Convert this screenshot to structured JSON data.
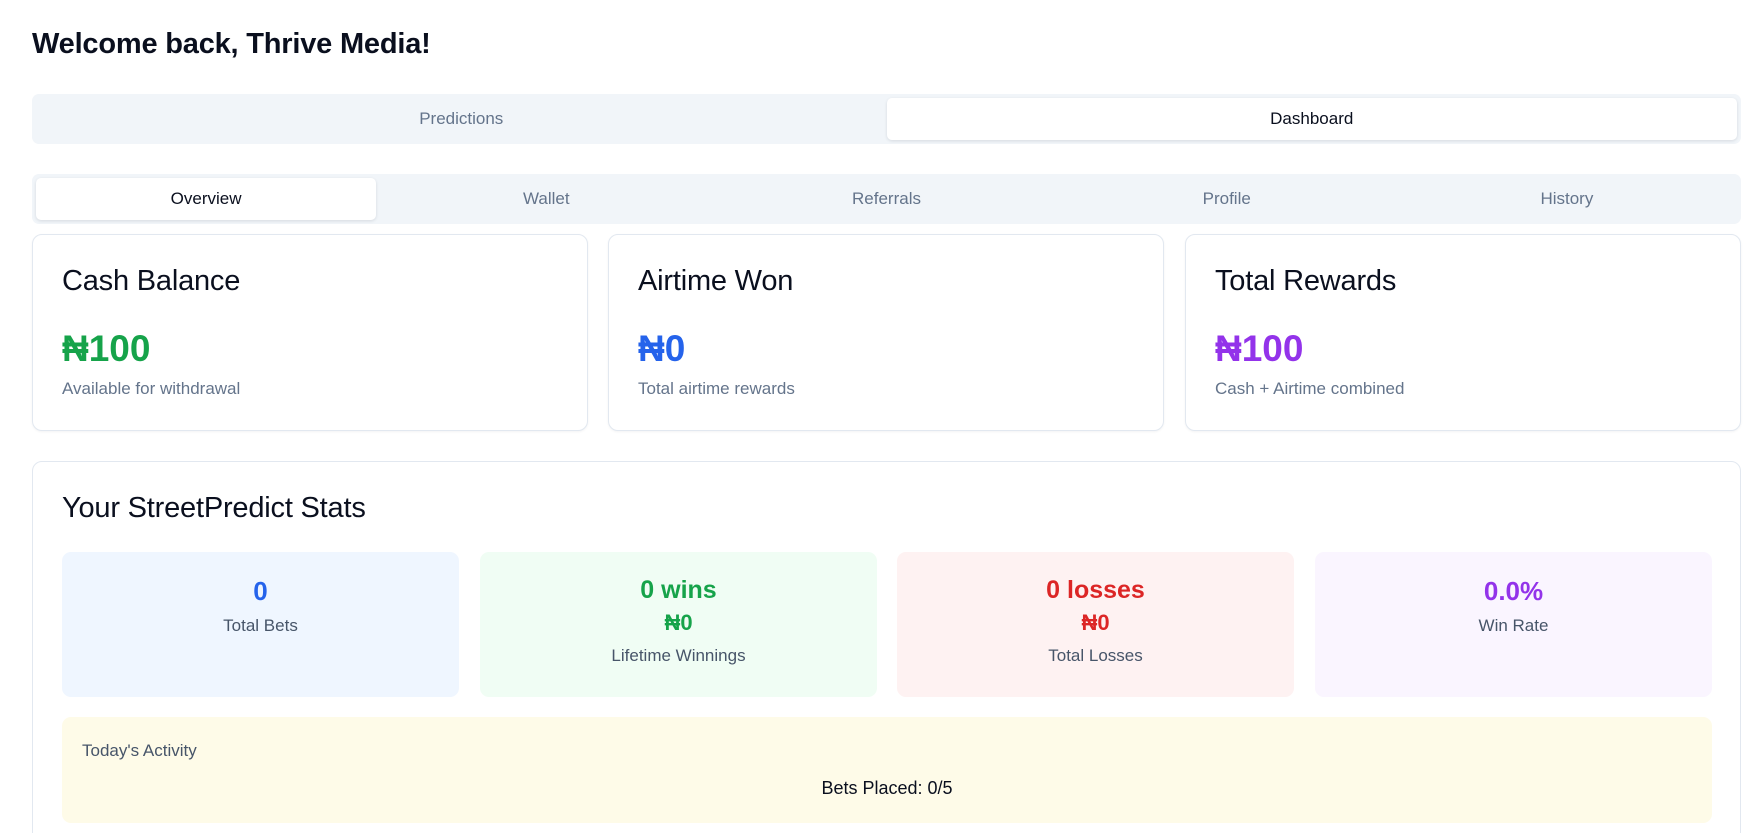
{
  "header": {
    "welcome": "Welcome back, Thrive Media!"
  },
  "main_tabs": [
    {
      "label": "Predictions",
      "active": false
    },
    {
      "label": "Dashboard",
      "active": true
    }
  ],
  "sub_tabs": [
    {
      "label": "Overview",
      "active": true
    },
    {
      "label": "Wallet",
      "active": false
    },
    {
      "label": "Referrals",
      "active": false
    },
    {
      "label": "Profile",
      "active": false
    },
    {
      "label": "History",
      "active": false
    }
  ],
  "cards": [
    {
      "title": "Cash Balance",
      "value": "₦100",
      "subtitle": "Available for withdrawal",
      "color": "#16a34a"
    },
    {
      "title": "Airtime Won",
      "value": "₦0",
      "subtitle": "Total airtime rewards",
      "color": "#2563eb"
    },
    {
      "title": "Total Rewards",
      "value": "₦100",
      "subtitle": "Cash + Airtime combined",
      "color": "#9333ea"
    }
  ],
  "stats": {
    "title": "Your StreetPredict Stats",
    "total_bets": {
      "value": "0",
      "label": "Total Bets",
      "color": "#2563eb",
      "bg": "#eff6ff"
    },
    "wins": {
      "value": "0 wins",
      "amount": "₦0",
      "label": "Lifetime Winnings",
      "color": "#16a34a",
      "bg": "#f0fdf4"
    },
    "losses": {
      "value": "0 losses",
      "amount": "₦0",
      "label": "Total Losses",
      "color": "#dc2626",
      "bg": "#fef2f2"
    },
    "win_rate": {
      "value": "0.0%",
      "label": "Win Rate",
      "color": "#9333ea",
      "bg": "#faf5ff"
    }
  },
  "activity": {
    "title": "Today's Activity",
    "bets_label": "Bets Placed:",
    "bets_value": "0/5"
  }
}
